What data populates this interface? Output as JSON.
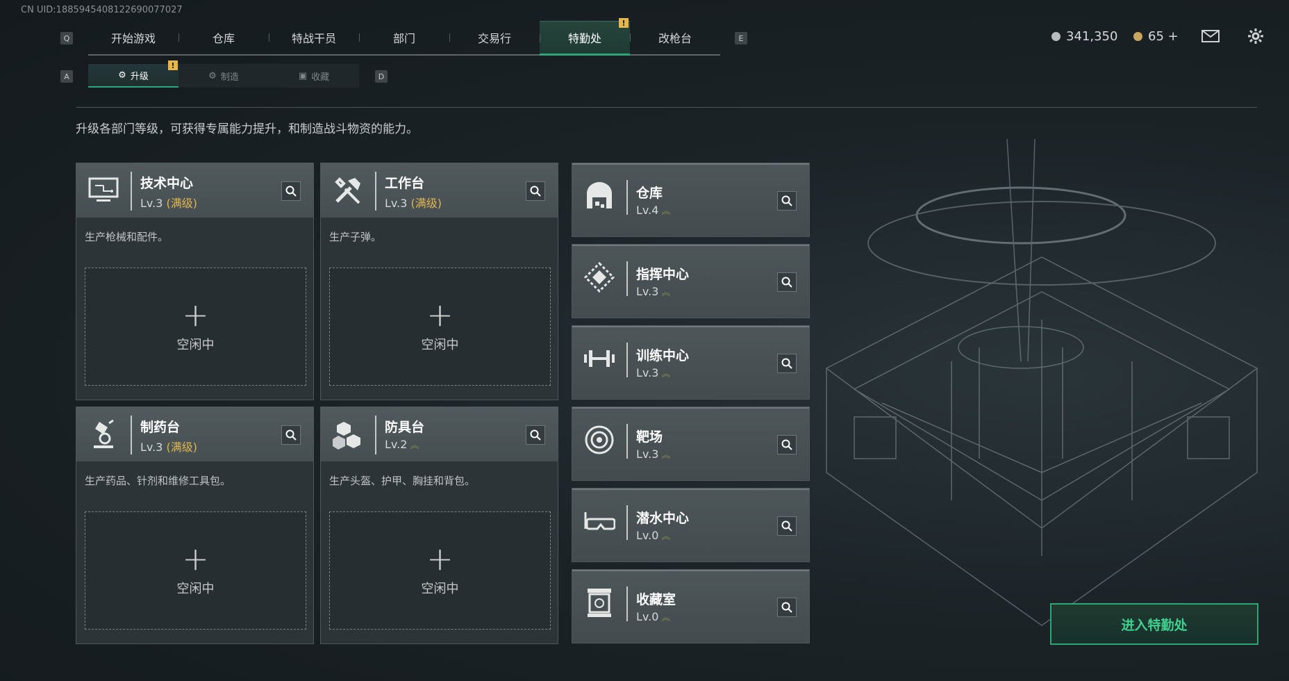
{
  "uid": "CN UID:1885945408122690077027",
  "top_nav": {
    "left_key": "Q",
    "right_key": "E",
    "tabs": [
      "开始游戏",
      "仓库",
      "特战干员",
      "部门",
      "交易行",
      "特勤处",
      "改枪台"
    ],
    "active_index": 5
  },
  "sub_nav": {
    "left_key": "A",
    "right_key": "D",
    "tabs": [
      "升级",
      "制造",
      "收藏"
    ],
    "active_index": 0
  },
  "badge_text": "!",
  "description": "升级各部门等级，可获得专属能力提升，和制造战斗物资的能力。",
  "currency": {
    "silver": "341,350",
    "gold": "65 +"
  },
  "production_cards": [
    {
      "name": "技术中心",
      "level": "Lv.3",
      "max": "(满级)",
      "info": "生产枪械和配件。",
      "slot": "空闲中",
      "icon": "computer-icon"
    },
    {
      "name": "工作台",
      "level": "Lv.3",
      "max": "(满级)",
      "info": "生产子弹。",
      "slot": "空闲中",
      "icon": "tools-icon"
    },
    {
      "name": "制药台",
      "level": "Lv.3",
      "max": "(满级)",
      "info": "生产药品、针剂和维修工具包。",
      "slot": "空闲中",
      "icon": "microscope-icon"
    },
    {
      "name": "防具台",
      "level": "Lv.2",
      "max": "",
      "info": "生产头盔、护甲、胸挂和背包。",
      "slot": "空闲中",
      "icon": "cubes-icon"
    }
  ],
  "department_cards": [
    {
      "name": "仓库",
      "level": "Lv.4",
      "icon": "warehouse-icon"
    },
    {
      "name": "指挥中心",
      "level": "Lv.3",
      "icon": "command-icon"
    },
    {
      "name": "训练中心",
      "level": "Lv.3",
      "icon": "dumbbell-icon"
    },
    {
      "name": "靶场",
      "level": "Lv.3",
      "icon": "target-icon"
    },
    {
      "name": "潜水中心",
      "level": "Lv.0",
      "icon": "dive-mask-icon"
    },
    {
      "name": "收藏室",
      "level": "Lv.0",
      "icon": "collection-icon"
    }
  ],
  "enter_button": "进入特勤处",
  "colors": {
    "accent": "#2ea777",
    "max_level": "#e0b64f",
    "badge": "#e6b64a"
  }
}
